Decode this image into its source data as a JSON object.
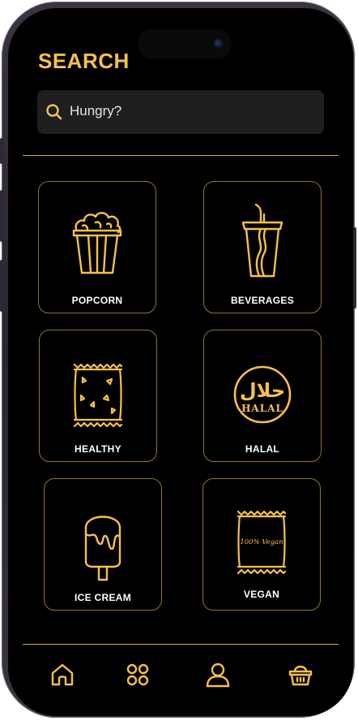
{
  "page": {
    "title": "SEARCH"
  },
  "search": {
    "placeholder": "Hungry?"
  },
  "categories": [
    {
      "label": "POPCORN",
      "icon": "popcorn-icon"
    },
    {
      "label": "BEVERAGES",
      "icon": "cup-with-straw-icon"
    },
    {
      "label": "HEALTHY",
      "icon": "snack-bag-icon"
    },
    {
      "label": "HALAL",
      "icon": "halal-seal-icon"
    },
    {
      "label": "ICE CREAM",
      "icon": "ice-cream-bar-icon"
    },
    {
      "label": "VEGAN",
      "icon": "vegan-bag-icon"
    }
  ],
  "vegan_bag_text": "100% Vegan",
  "halal_seal": {
    "arabic": "حلال",
    "latin": "HALAL"
  },
  "nav": [
    {
      "icon": "home-icon"
    },
    {
      "icon": "grid-icon"
    },
    {
      "icon": "user-icon"
    },
    {
      "icon": "basket-icon"
    }
  ],
  "colors": {
    "accent": "#F6C14A",
    "background": "#000000",
    "card_border": "#8f7330",
    "search_bg": "#1f1f21",
    "label": "#ffffff"
  }
}
